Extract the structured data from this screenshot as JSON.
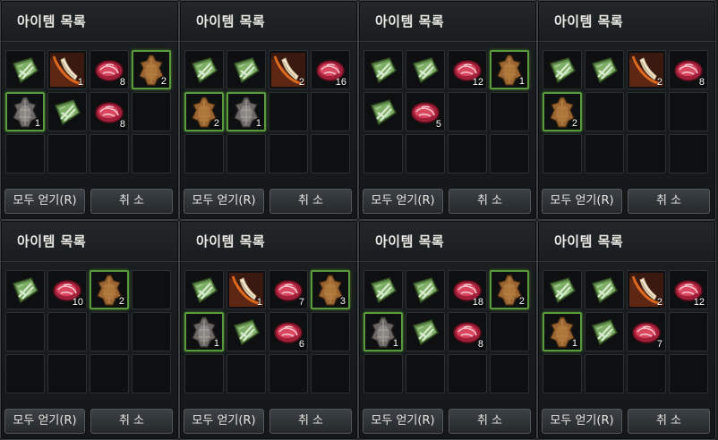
{
  "labels": {
    "title": "아이템 목록",
    "get_all": "모두 얻기(R)",
    "cancel": "취 소"
  },
  "colors": {
    "selected_border": "#5a9a3c",
    "panel_bg": "#1b1e20"
  },
  "panels": [
    {
      "slots": [
        {
          "icon": "herb-bundle-icon",
          "count": "",
          "sel": false
        },
        {
          "icon": "horn-icon",
          "count": "1",
          "sel": false
        },
        {
          "icon": "raw-meat-icon",
          "count": "8",
          "sel": false
        },
        {
          "icon": "brown-hide-icon",
          "count": "2",
          "sel": true
        },
        {
          "icon": "gray-hide-icon",
          "count": "1",
          "sel": true
        },
        {
          "icon": "herb-bundle-icon",
          "count": "",
          "sel": false
        },
        {
          "icon": "raw-meat-icon",
          "count": "8",
          "sel": false
        },
        null,
        null,
        null,
        null,
        null
      ]
    },
    {
      "slots": [
        {
          "icon": "herb-bundle-icon",
          "count": "",
          "sel": false
        },
        {
          "icon": "herb-bundle-icon",
          "count": "",
          "sel": false
        },
        {
          "icon": "horn-icon",
          "count": "2",
          "sel": false
        },
        {
          "icon": "raw-meat-icon",
          "count": "16",
          "sel": false
        },
        {
          "icon": "brown-hide-icon",
          "count": "2",
          "sel": true
        },
        {
          "icon": "gray-hide-icon",
          "count": "1",
          "sel": true
        },
        null,
        null,
        null,
        null,
        null,
        null
      ]
    },
    {
      "slots": [
        {
          "icon": "herb-bundle-icon",
          "count": "",
          "sel": false
        },
        {
          "icon": "herb-bundle-icon",
          "count": "",
          "sel": false
        },
        {
          "icon": "raw-meat-icon",
          "count": "12",
          "sel": false
        },
        {
          "icon": "brown-hide-icon",
          "count": "1",
          "sel": true
        },
        {
          "icon": "herb-bundle-icon",
          "count": "",
          "sel": false
        },
        {
          "icon": "raw-meat-icon",
          "count": "5",
          "sel": false
        },
        null,
        null,
        null,
        null,
        null,
        null
      ]
    },
    {
      "slots": [
        {
          "icon": "herb-bundle-icon",
          "count": "",
          "sel": false
        },
        {
          "icon": "herb-bundle-icon",
          "count": "",
          "sel": false
        },
        {
          "icon": "horn-icon",
          "count": "2",
          "sel": false
        },
        {
          "icon": "raw-meat-icon",
          "count": "8",
          "sel": false
        },
        {
          "icon": "brown-hide-icon",
          "count": "2",
          "sel": true
        },
        null,
        null,
        null,
        null,
        null,
        null,
        null
      ]
    },
    {
      "slots": [
        {
          "icon": "herb-bundle-icon",
          "count": "",
          "sel": false
        },
        {
          "icon": "raw-meat-icon",
          "count": "10",
          "sel": false
        },
        {
          "icon": "brown-hide-icon",
          "count": "2",
          "sel": true
        },
        null,
        null,
        null,
        null,
        null,
        null,
        null,
        null,
        null
      ]
    },
    {
      "slots": [
        {
          "icon": "herb-bundle-icon",
          "count": "",
          "sel": false
        },
        {
          "icon": "horn-icon",
          "count": "1",
          "sel": false
        },
        {
          "icon": "raw-meat-icon",
          "count": "7",
          "sel": false
        },
        {
          "icon": "brown-hide-icon",
          "count": "3",
          "sel": true
        },
        {
          "icon": "gray-hide-icon",
          "count": "1",
          "sel": true
        },
        {
          "icon": "herb-bundle-icon",
          "count": "",
          "sel": false
        },
        {
          "icon": "raw-meat-icon",
          "count": "6",
          "sel": false
        },
        null,
        null,
        null,
        null,
        null
      ]
    },
    {
      "slots": [
        {
          "icon": "herb-bundle-icon",
          "count": "",
          "sel": false
        },
        {
          "icon": "herb-bundle-icon",
          "count": "",
          "sel": false
        },
        {
          "icon": "raw-meat-icon",
          "count": "18",
          "sel": false
        },
        {
          "icon": "brown-hide-icon",
          "count": "2",
          "sel": true
        },
        {
          "icon": "gray-hide-icon",
          "count": "1",
          "sel": true
        },
        {
          "icon": "herb-bundle-icon",
          "count": "",
          "sel": false
        },
        {
          "icon": "raw-meat-icon",
          "count": "8",
          "sel": false
        },
        null,
        null,
        null,
        null,
        null
      ]
    },
    {
      "slots": [
        {
          "icon": "herb-bundle-icon",
          "count": "",
          "sel": false
        },
        {
          "icon": "herb-bundle-icon",
          "count": "",
          "sel": false
        },
        {
          "icon": "horn-icon",
          "count": "2",
          "sel": false
        },
        {
          "icon": "raw-meat-icon",
          "count": "12",
          "sel": false
        },
        {
          "icon": "brown-hide-icon",
          "count": "1",
          "sel": true
        },
        {
          "icon": "herb-bundle-icon",
          "count": "",
          "sel": false
        },
        {
          "icon": "raw-meat-icon",
          "count": "7",
          "sel": false
        },
        null,
        null,
        null,
        null,
        null
      ]
    }
  ]
}
